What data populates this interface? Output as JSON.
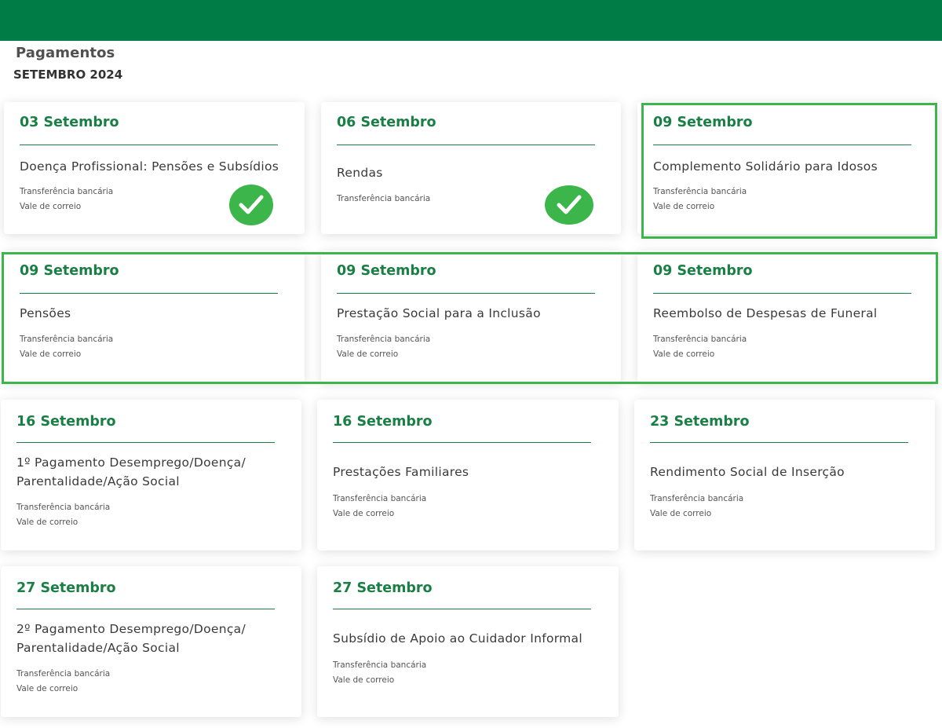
{
  "header": {
    "title": "Pagamentos",
    "subtitle": "SETEMBRO 2024",
    "accent_color": "#007c46"
  },
  "cards": [
    {
      "date": "03 Setembro",
      "title": "Doença Profissional: Pensões e Subsídios",
      "methods": [
        "Transferência bancária",
        "Vale de correio"
      ],
      "status": "check-icon"
    },
    {
      "date": "06 Setembro",
      "title": "Rendas",
      "methods": [
        "Transferência bancária"
      ],
      "status": "check-icon"
    },
    {
      "date": "09 Setembro",
      "title": "Complemento Solidário para Idosos",
      "methods": [
        "Transferência bancária",
        "Vale de correio"
      ]
    },
    {
      "date": "09 Setembro",
      "title": "Pensões",
      "methods": [
        "Transferência bancária",
        "Vale de correio"
      ]
    },
    {
      "date": "09 Setembro",
      "title": "Prestação Social para a Inclusão",
      "methods": [
        "Transferência bancária",
        "Vale de correio"
      ]
    },
    {
      "date": "09 Setembro",
      "title": "Reembolso de Despesas de Funeral",
      "methods": [
        "Transferência bancária",
        "Vale de correio"
      ]
    },
    {
      "date": "16 Setembro",
      "title": "1º Pagamento Desemprego/Doença/ Parentalidade/Ação Social",
      "methods": [
        "Transferência bancária",
        "Vale de correio"
      ]
    },
    {
      "date": "16 Setembro",
      "title": "Prestações Familiares",
      "methods": [
        "Transferência bancária",
        "Vale de correio"
      ]
    },
    {
      "date": "23 Setembro",
      "title": "Rendimento Social de Inserção",
      "methods": [
        "Transferência bancária",
        "Vale de correio"
      ]
    },
    {
      "date": "27 Setembro",
      "title": "2º Pagamento Desemprego/Doença/ Parentalidade/Ação Social",
      "methods": [
        "Transferência bancária",
        "Vale de correio"
      ]
    },
    {
      "date": "27 Setembro",
      "title": "Subsídio de Apoio ao Cuidador Informal",
      "methods": [
        "Transferência bancária",
        "Vale de correio"
      ]
    }
  ],
  "colors": {
    "date_text": "#1a7f45",
    "check_fill": "#3cb54a",
    "highlight_border": "#3cb54a"
  }
}
